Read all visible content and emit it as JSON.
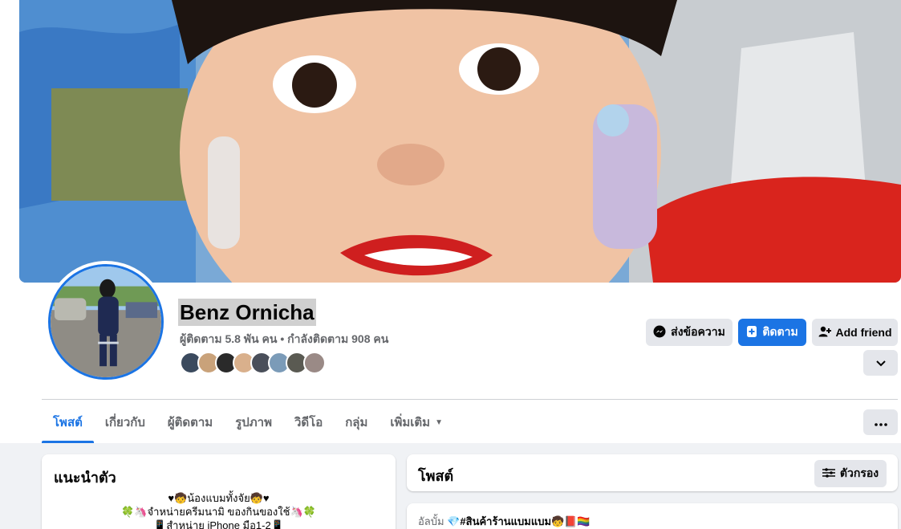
{
  "profile": {
    "name": "Benz Ornicha",
    "stats": "ผู้ติดตาม 5.8 พัน คน • กำลังติดตาม 908 คน",
    "friend_avatar_colors": [
      "#3b4a5e",
      "#c9a27a",
      "#2a2a2a",
      "#d9b08c",
      "#4a4f5a",
      "#7b9bb8",
      "#5a5a52",
      "#9a8a86"
    ]
  },
  "actions": {
    "message_label": "ส่งข้อความ",
    "follow_label": "ติดตาม",
    "add_friend_label": "Add friend"
  },
  "tabs": [
    {
      "label": "โพสต์"
    },
    {
      "label": "เกี่ยวกับ"
    },
    {
      "label": "ผู้ติดตาม"
    },
    {
      "label": "รูปภาพ"
    },
    {
      "label": "วิดีโอ"
    },
    {
      "label": "กลุ่ม"
    },
    {
      "label": "เพิ่มเติม"
    }
  ],
  "intro": {
    "title": "แนะนำตัว",
    "bio_lines": [
      "♥🧒น้องแบมทั้งจัย🧒♥",
      "🍀🦄จำหน่ายครีมนามิ ของกินของใช้🦄🍀",
      "📱สำหน่าย iPhone มือ1-2📱"
    ]
  },
  "posts": {
    "title": "โพสต์",
    "filter_label": "ตัวกรอง",
    "album_prefix": "อัลบั้ม",
    "album_name": "💎#สินค้าร้านแบมแบม🧒📕🏳️‍🌈"
  },
  "colors": {
    "accent": "#1b74e4",
    "button_gray": "#e4e6eb",
    "page_bg": "#f0f2f5"
  },
  "icons": {
    "message": "messenger-icon",
    "follow": "follow-icon",
    "add_friend": "add-friend-icon",
    "chevron": "chevron-down-icon",
    "more": "more-dots-icon",
    "filter": "filter-icon"
  }
}
